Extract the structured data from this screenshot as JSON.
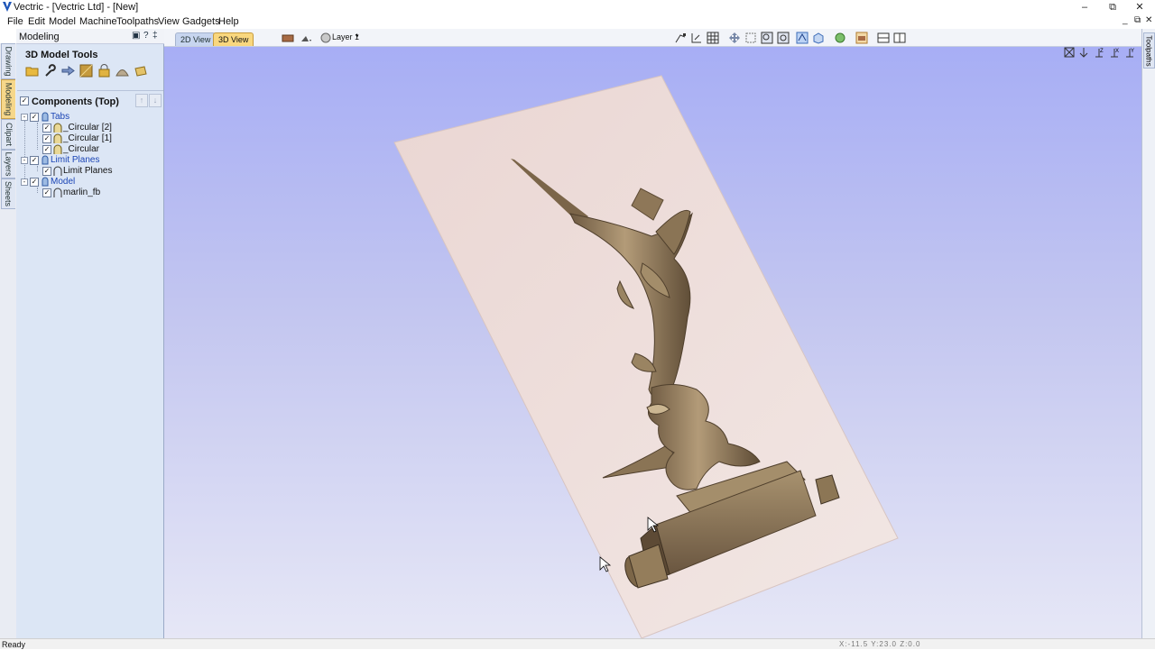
{
  "window": {
    "title": "Vectric - [Vectric Ltd] - [New]",
    "minimize_label": "–",
    "maximize_label": "⧉",
    "close_label": "✕"
  },
  "menu": {
    "items": [
      "File",
      "Edit",
      "Model",
      "Machine",
      "Toolpaths",
      "View",
      "Gadgets",
      "Help"
    ]
  },
  "left_tabs": [
    "Drawing",
    "Modeling",
    "Clipart",
    "Layers",
    "Sheets"
  ],
  "panel": {
    "title": "Modeling",
    "help_label": "?",
    "pin_label": "‡",
    "tools_title": "3D Model Tools",
    "tool_icons": [
      "open-folder-icon",
      "wrench-icon",
      "arrow-icon",
      "texture-icon",
      "lock-icon",
      "dome-icon",
      "pencil-icon"
    ],
    "components_title": "Components (Top)",
    "move_up_label": "↑",
    "move_down_label": "↓",
    "tree": {
      "tabs_label": "Tabs",
      "circular2": "_Circular [2]",
      "circular1": "_Circular [1]",
      "circular": "_Circular",
      "limit_planes_group": "Limit Planes",
      "limit_planes_item": "Limit Planes",
      "model_group": "Model",
      "model_item": "marlin_fb"
    }
  },
  "viewbar": {
    "tab_2d": "2D View",
    "tab_3d": "3D View",
    "active_tab": "3D View",
    "layer": "Layer 1"
  },
  "right_tab": "Toolpaths",
  "status": {
    "text": "Ready",
    "coords": "X:-11.5  Y:23.0  Z:0.0"
  },
  "colors": {
    "viewport_top": "#a7aef5",
    "viewport_bottom": "#e6e7f6",
    "material": "#ecdcdc",
    "model": "#8a7457",
    "active_tab": "#f9d77e"
  }
}
